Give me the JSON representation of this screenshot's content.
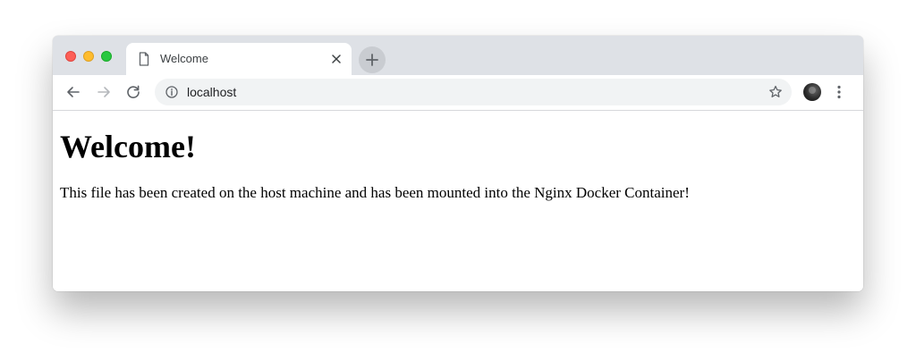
{
  "colors": {
    "tabstrip": "#dee1e6",
    "omnibox": "#f1f3f4",
    "close_button": "#fd5f57",
    "minimize_button": "#febc2e",
    "zoom_button": "#28c840"
  },
  "tab": {
    "title": "Welcome",
    "icon": "document-icon",
    "close_icon": "close-icon"
  },
  "toolbar": {
    "back_icon": "arrow-left-icon",
    "forward_icon": "arrow-right-icon",
    "reload_icon": "reload-icon",
    "new_tab_icon": "plus-icon",
    "bookmark_icon": "star-icon",
    "menu_icon": "more-vertical-icon"
  },
  "omnibox": {
    "url": "localhost",
    "security_icon": "info-icon"
  },
  "page": {
    "heading": "Welcome!",
    "body": "This file has been created on the host machine and has been mounted into the Nginx Docker Container!"
  }
}
